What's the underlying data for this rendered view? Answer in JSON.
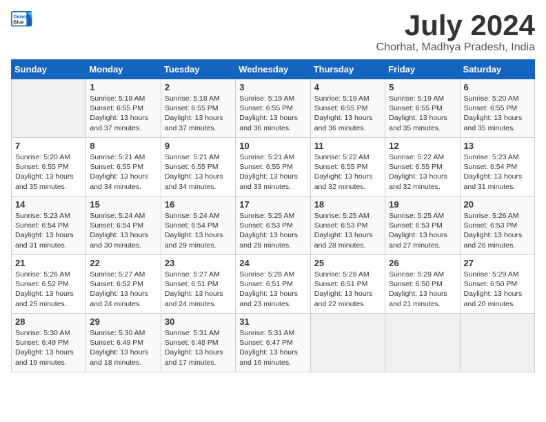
{
  "logo": {
    "line1": "General",
    "line2": "Blue"
  },
  "title": "July 2024",
  "location": "Chorhat, Madhya Pradesh, India",
  "days_of_week": [
    "Sunday",
    "Monday",
    "Tuesday",
    "Wednesday",
    "Thursday",
    "Friday",
    "Saturday"
  ],
  "weeks": [
    [
      {
        "day": "",
        "sunrise": "",
        "sunset": "",
        "daylight": ""
      },
      {
        "day": "1",
        "sunrise": "Sunrise: 5:18 AM",
        "sunset": "Sunset: 6:55 PM",
        "daylight": "Daylight: 13 hours and 37 minutes."
      },
      {
        "day": "2",
        "sunrise": "Sunrise: 5:18 AM",
        "sunset": "Sunset: 6:55 PM",
        "daylight": "Daylight: 13 hours and 37 minutes."
      },
      {
        "day": "3",
        "sunrise": "Sunrise: 5:19 AM",
        "sunset": "Sunset: 6:55 PM",
        "daylight": "Daylight: 13 hours and 36 minutes."
      },
      {
        "day": "4",
        "sunrise": "Sunrise: 5:19 AM",
        "sunset": "Sunset: 6:55 PM",
        "daylight": "Daylight: 13 hours and 36 minutes."
      },
      {
        "day": "5",
        "sunrise": "Sunrise: 5:19 AM",
        "sunset": "Sunset: 6:55 PM",
        "daylight": "Daylight: 13 hours and 35 minutes."
      },
      {
        "day": "6",
        "sunrise": "Sunrise: 5:20 AM",
        "sunset": "Sunset: 6:55 PM",
        "daylight": "Daylight: 13 hours and 35 minutes."
      }
    ],
    [
      {
        "day": "7",
        "sunrise": "Sunrise: 5:20 AM",
        "sunset": "Sunset: 6:55 PM",
        "daylight": "Daylight: 13 hours and 35 minutes."
      },
      {
        "day": "8",
        "sunrise": "Sunrise: 5:21 AM",
        "sunset": "Sunset: 6:55 PM",
        "daylight": "Daylight: 13 hours and 34 minutes."
      },
      {
        "day": "9",
        "sunrise": "Sunrise: 5:21 AM",
        "sunset": "Sunset: 6:55 PM",
        "daylight": "Daylight: 13 hours and 34 minutes."
      },
      {
        "day": "10",
        "sunrise": "Sunrise: 5:21 AM",
        "sunset": "Sunset: 6:55 PM",
        "daylight": "Daylight: 13 hours and 33 minutes."
      },
      {
        "day": "11",
        "sunrise": "Sunrise: 5:22 AM",
        "sunset": "Sunset: 6:55 PM",
        "daylight": "Daylight: 13 hours and 32 minutes."
      },
      {
        "day": "12",
        "sunrise": "Sunrise: 5:22 AM",
        "sunset": "Sunset: 6:55 PM",
        "daylight": "Daylight: 13 hours and 32 minutes."
      },
      {
        "day": "13",
        "sunrise": "Sunrise: 5:23 AM",
        "sunset": "Sunset: 6:54 PM",
        "daylight": "Daylight: 13 hours and 31 minutes."
      }
    ],
    [
      {
        "day": "14",
        "sunrise": "Sunrise: 5:23 AM",
        "sunset": "Sunset: 6:54 PM",
        "daylight": "Daylight: 13 hours and 31 minutes."
      },
      {
        "day": "15",
        "sunrise": "Sunrise: 5:24 AM",
        "sunset": "Sunset: 6:54 PM",
        "daylight": "Daylight: 13 hours and 30 minutes."
      },
      {
        "day": "16",
        "sunrise": "Sunrise: 5:24 AM",
        "sunset": "Sunset: 6:54 PM",
        "daylight": "Daylight: 13 hours and 29 minutes."
      },
      {
        "day": "17",
        "sunrise": "Sunrise: 5:25 AM",
        "sunset": "Sunset: 6:53 PM",
        "daylight": "Daylight: 13 hours and 28 minutes."
      },
      {
        "day": "18",
        "sunrise": "Sunrise: 5:25 AM",
        "sunset": "Sunset: 6:53 PM",
        "daylight": "Daylight: 13 hours and 28 minutes."
      },
      {
        "day": "19",
        "sunrise": "Sunrise: 5:25 AM",
        "sunset": "Sunset: 6:53 PM",
        "daylight": "Daylight: 13 hours and 27 minutes."
      },
      {
        "day": "20",
        "sunrise": "Sunrise: 5:26 AM",
        "sunset": "Sunset: 6:53 PM",
        "daylight": "Daylight: 13 hours and 26 minutes."
      }
    ],
    [
      {
        "day": "21",
        "sunrise": "Sunrise: 5:26 AM",
        "sunset": "Sunset: 6:52 PM",
        "daylight": "Daylight: 13 hours and 25 minutes."
      },
      {
        "day": "22",
        "sunrise": "Sunrise: 5:27 AM",
        "sunset": "Sunset: 6:52 PM",
        "daylight": "Daylight: 13 hours and 24 minutes."
      },
      {
        "day": "23",
        "sunrise": "Sunrise: 5:27 AM",
        "sunset": "Sunset: 6:51 PM",
        "daylight": "Daylight: 13 hours and 24 minutes."
      },
      {
        "day": "24",
        "sunrise": "Sunrise: 5:28 AM",
        "sunset": "Sunset: 6:51 PM",
        "daylight": "Daylight: 13 hours and 23 minutes."
      },
      {
        "day": "25",
        "sunrise": "Sunrise: 5:28 AM",
        "sunset": "Sunset: 6:51 PM",
        "daylight": "Daylight: 13 hours and 22 minutes."
      },
      {
        "day": "26",
        "sunrise": "Sunrise: 5:29 AM",
        "sunset": "Sunset: 6:50 PM",
        "daylight": "Daylight: 13 hours and 21 minutes."
      },
      {
        "day": "27",
        "sunrise": "Sunrise: 5:29 AM",
        "sunset": "Sunset: 6:50 PM",
        "daylight": "Daylight: 13 hours and 20 minutes."
      }
    ],
    [
      {
        "day": "28",
        "sunrise": "Sunrise: 5:30 AM",
        "sunset": "Sunset: 6:49 PM",
        "daylight": "Daylight: 13 hours and 19 minutes."
      },
      {
        "day": "29",
        "sunrise": "Sunrise: 5:30 AM",
        "sunset": "Sunset: 6:49 PM",
        "daylight": "Daylight: 13 hours and 18 minutes."
      },
      {
        "day": "30",
        "sunrise": "Sunrise: 5:31 AM",
        "sunset": "Sunset: 6:48 PM",
        "daylight": "Daylight: 13 hours and 17 minutes."
      },
      {
        "day": "31",
        "sunrise": "Sunrise: 5:31 AM",
        "sunset": "Sunset: 6:47 PM",
        "daylight": "Daylight: 13 hours and 16 minutes."
      },
      {
        "day": "",
        "sunrise": "",
        "sunset": "",
        "daylight": ""
      },
      {
        "day": "",
        "sunrise": "",
        "sunset": "",
        "daylight": ""
      },
      {
        "day": "",
        "sunrise": "",
        "sunset": "",
        "daylight": ""
      }
    ]
  ]
}
